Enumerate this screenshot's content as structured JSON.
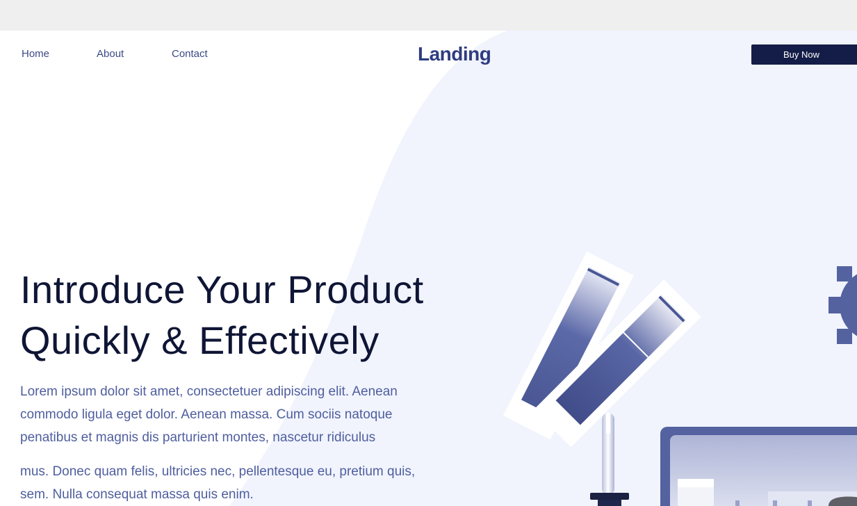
{
  "nav": {
    "links": [
      "Home",
      "About",
      "Contact"
    ]
  },
  "brand": {
    "logo_text": "Landing"
  },
  "cta": {
    "buy_label": "Buy Now"
  },
  "hero": {
    "headline_line1": "Introduce Your Product",
    "headline_line2": "Quickly & Effectively",
    "paragraph1": "Lorem ipsum dolor sit amet, consectetuer adipiscing elit. Aenean commodo ligula eget dolor. Aenean massa. Cum sociis natoque penatibus et magnis dis parturient montes, nascetur ridiculus",
    "paragraph2": "mus. Donec quam felis, ultricies nec, pellentesque eu, pretium quis, sem. Nulla consequat massa quis enim."
  },
  "illustration": {
    "icons": [
      "color-swatch-icon",
      "eyedropper-icon",
      "gear-icon",
      "monitor-icon"
    ]
  },
  "colors": {
    "accent": "#2f3c80",
    "button": "#141d47",
    "headline": "#0f1535",
    "body_text": "#4f5e9e",
    "panel_bg": "#f1f4fd",
    "illustration": "#5462a0"
  }
}
